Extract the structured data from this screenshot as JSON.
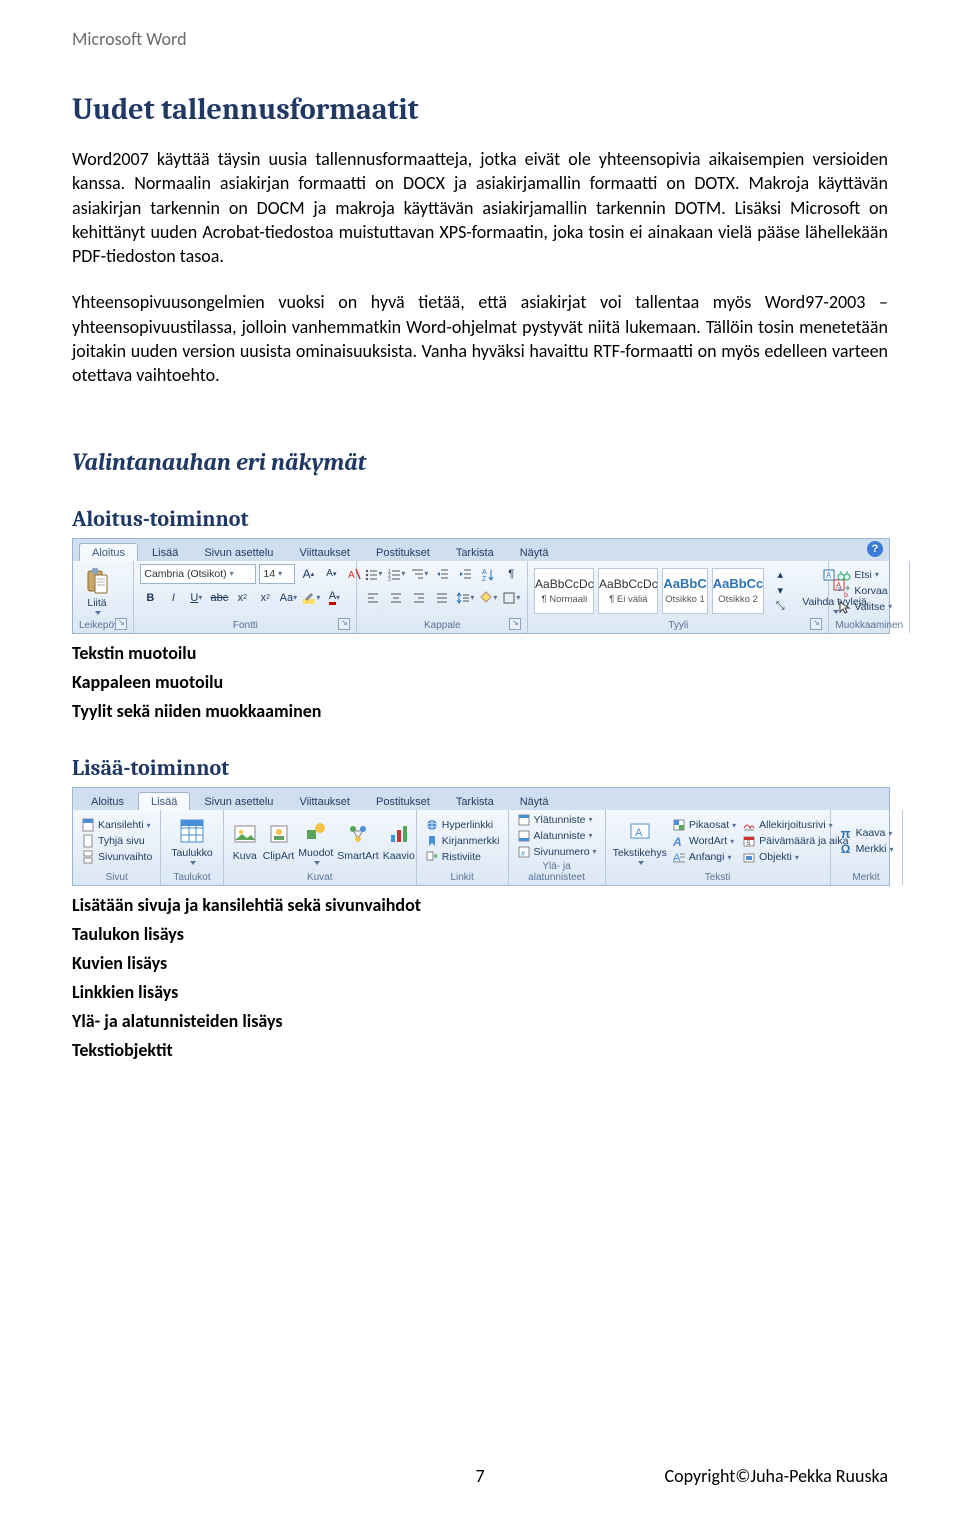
{
  "doc_header": "Microsoft Word",
  "h1": "Uudet tallennusformaatit",
  "para1": "Word2007 käyttää täysin uusia tallennusformaatteja, jotka eivät ole yhteensopivia aikaisempien versioiden kanssa. Normaalin asiakirjan formaatti on DOCX ja asiakirjamallin formaatti on DOTX. Makroja käyttävän asiakirjan tarkennin on DOCM ja makroja käyttävän asiakirjamallin tarkennin DOTM. Lisäksi Microsoft on kehittänyt uuden Acrobat-tiedostoa muistuttavan XPS-formaatin, joka tosin ei ainakaan vielä pääse lähellekään PDF-tiedoston tasoa.",
  "para2": "Yhteensopivuusongelmien vuoksi on hyvä tietää, että asiakirjat voi tallentaa myös Word97-2003 – yhteensopivuustilassa, jolloin vanhemmatkin Word-ohjelmat pystyvät niitä lukemaan. Tällöin tosin menetetään joitakin uuden version uusista ominaisuuksista.  Vanha hyväksi havaittu RTF-formaatti on myös edelleen varteen otettava vaihtoehto.",
  "h2": "Valintanauhan eri näkymät",
  "section_aloitus": "Aloitus-toiminnot",
  "bullets_aloitus": [
    "Tekstin muotoilu",
    "Kappaleen muotoilu",
    "Tyylit sekä niiden muokkaaminen"
  ],
  "section_lisaa": "Lisää-toiminnot",
  "bullets_lisaa": [
    "Lisätään sivuja ja kansilehtiä sekä sivunvaihdot",
    "Taulukon lisäys",
    "Kuvien lisäys",
    "Linkkien lisäys",
    "Ylä- ja alatunnisteiden lisäys",
    "Tekstiobjektit"
  ],
  "footer_page": "7",
  "footer_copy": "Copyright©Juha-Pekka Ruuska",
  "ribbon_aloitus": {
    "tabs": [
      "Aloitus",
      "Lisää",
      "Sivun asettelu",
      "Viittaukset",
      "Postitukset",
      "Tarkista",
      "Näytä"
    ],
    "active_tab": 0,
    "clipboard": {
      "paste": "Liitä",
      "group": "Leikepöytä"
    },
    "font": {
      "family": "Cambria (Otsikot)",
      "size": "14",
      "group": "Fontti"
    },
    "para": {
      "group": "Kappale"
    },
    "styles": {
      "group": "Tyyli",
      "items": [
        {
          "prev": "AaBbCcDc",
          "name": "¶ Normaali",
          "blue": false
        },
        {
          "prev": "AaBbCcDc",
          "name": "¶ Ei väliä",
          "blue": false
        },
        {
          "prev": "AaBbC",
          "name": "Otsikko 1",
          "blue": true
        },
        {
          "prev": "AaBbCc",
          "name": "Otsikko 2",
          "blue": true
        }
      ],
      "change": "Vaihda tyylejä"
    },
    "editing": {
      "group": "Muokkaaminen",
      "find": "Etsi",
      "replace": "Korvaa",
      "select": "Valitse"
    }
  },
  "ribbon_lisaa": {
    "tabs": [
      "Aloitus",
      "Lisää",
      "Sivun asettelu",
      "Viittaukset",
      "Postitukset",
      "Tarkista",
      "Näytä"
    ],
    "active_tab": 1,
    "pages": {
      "group": "Sivut",
      "cover": "Kansilehti",
      "blank": "Tyhjä sivu",
      "break": "Sivunvaihto"
    },
    "tables": {
      "group": "Taulukot",
      "btn": "Taulukko"
    },
    "illus": {
      "group": "Kuvat",
      "pic": "Kuva",
      "clip": "ClipArt",
      "shapes": "Muodot",
      "smart": "SmartArt",
      "chart": "Kaavio"
    },
    "links": {
      "group": "Linkit",
      "hyper": "Hyperlinkki",
      "book": "Kirjanmerkki",
      "cross": "Ristiviite"
    },
    "hf": {
      "group": "Ylä- ja alatunnisteet",
      "header": "Ylätunniste",
      "footer": "Alatunniste",
      "pagen": "Sivunumero"
    },
    "text": {
      "group": "Teksti",
      "textbox": "Tekstikehys",
      "quick": "Pikaosat",
      "wordart": "WordArt",
      "drop": "Anfangi",
      "sig": "Allekirjoitusrivi",
      "date": "Päivämäärä ja aika",
      "obj": "Objekti"
    },
    "symbols": {
      "group": "Merkit",
      "eq": "Kaava",
      "sym": "Merkki"
    }
  }
}
